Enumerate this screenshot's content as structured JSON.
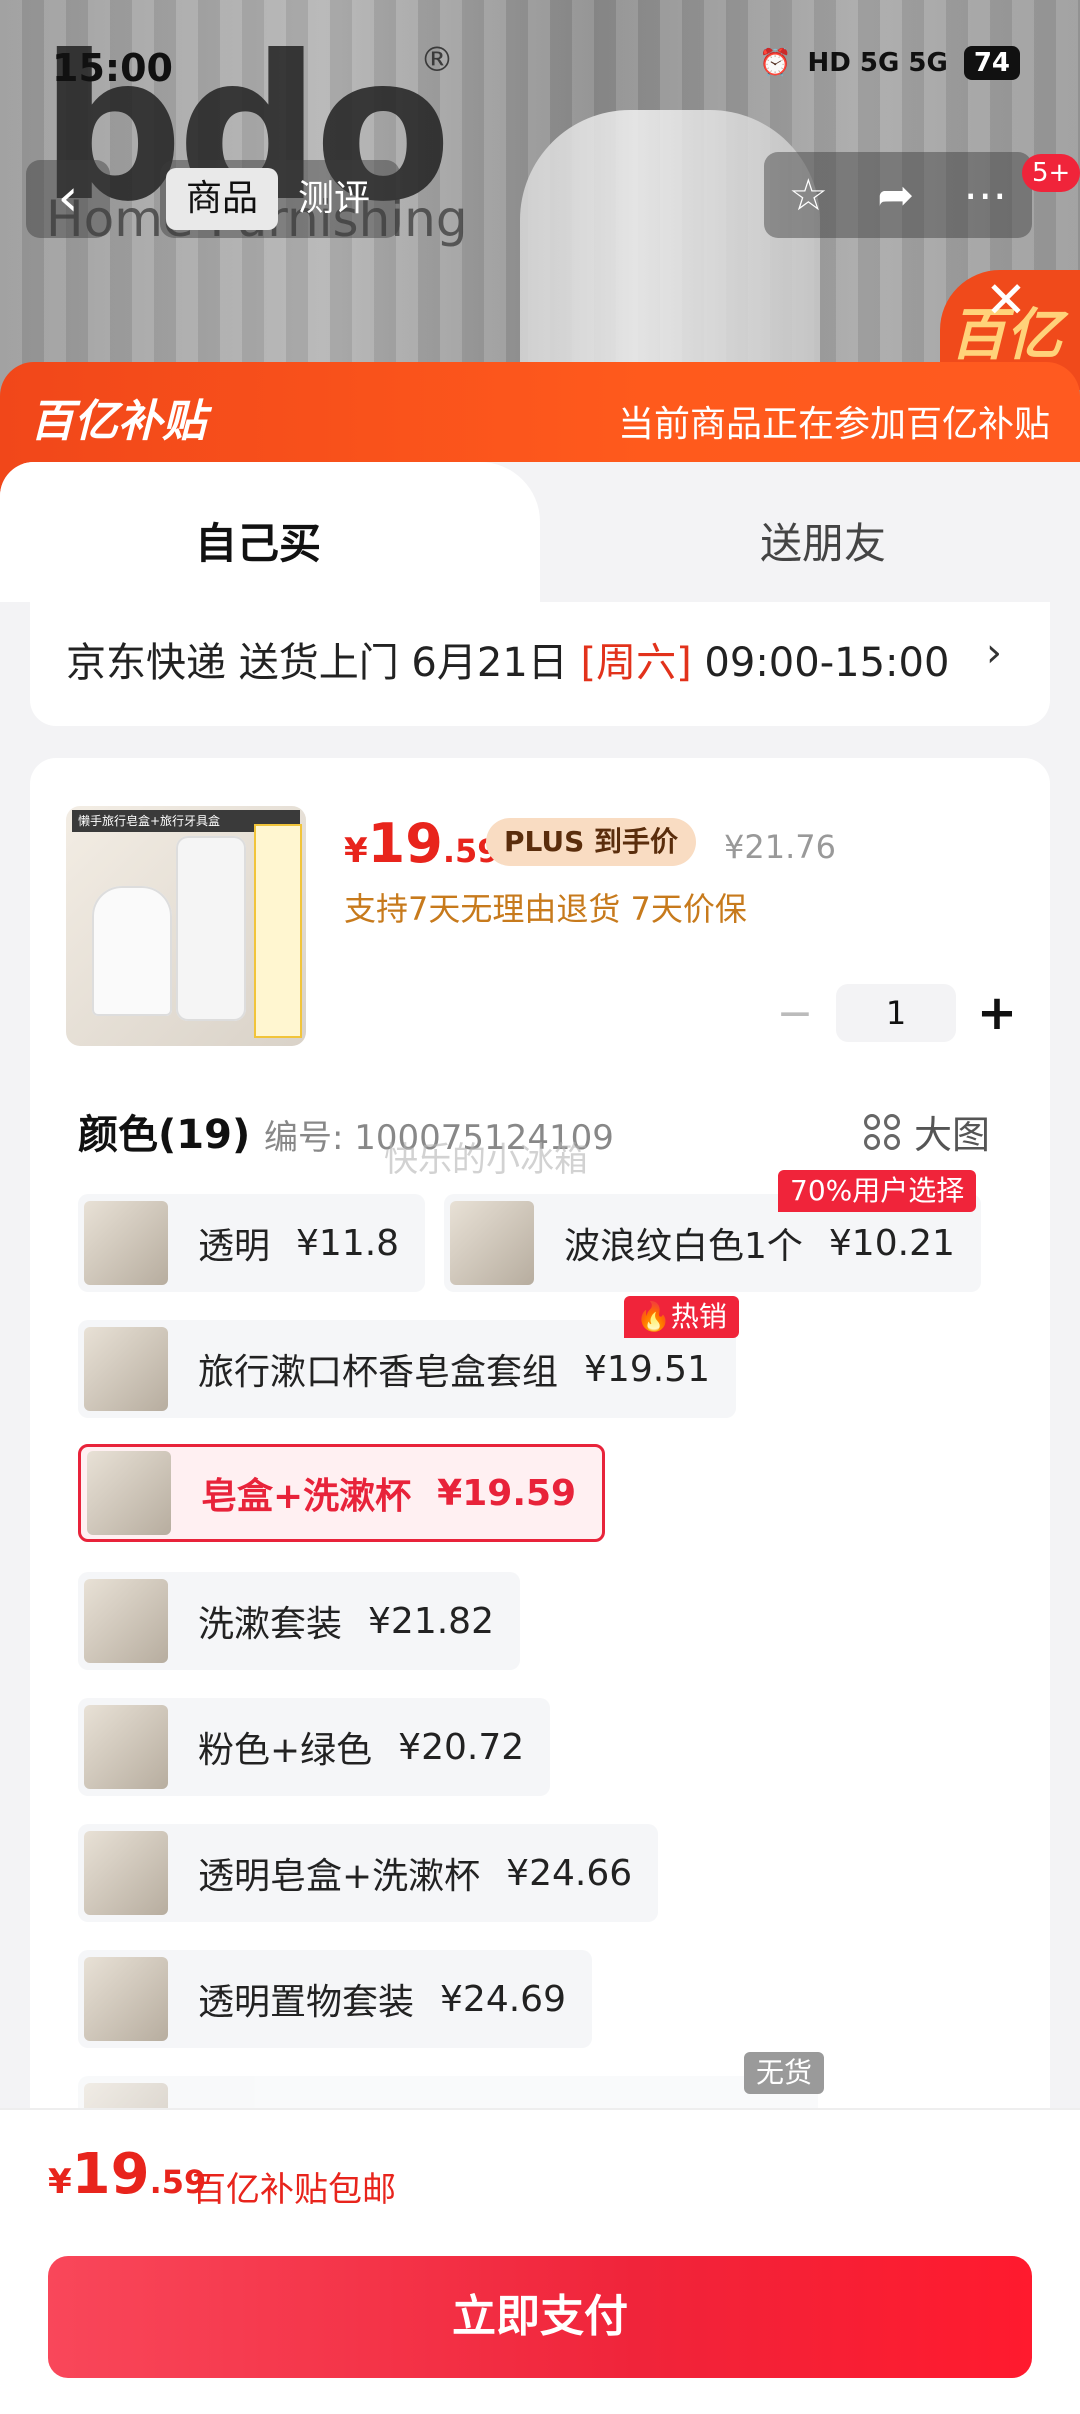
{
  "status_bar": {
    "time": "15:00",
    "network": "HD 5G 5G",
    "battery": "74"
  },
  "background": {
    "brand_logo": "bdo",
    "brand_sub": "Home Furnishing",
    "reg_mark": "®",
    "badge_text": "百亿"
  },
  "nav": {
    "back_icon": "chevron-left-icon",
    "tabs": [
      "商品",
      "测评"
    ],
    "message_count": "5+"
  },
  "banner": {
    "logo_prefix": "百",
    "logo_text": "亿补贴",
    "text": "当前商品正在参加百亿补贴"
  },
  "tabs": {
    "self": "自己买",
    "friend": "送朋友"
  },
  "delivery": {
    "text": "京东快递 送货上门 6月21日 ",
    "weekday": "[周六]",
    "time": " 09:00-15:00",
    "arrow": "›"
  },
  "product": {
    "thumb_header": "懒手旅行皂盒+旅行牙具盒",
    "price_currency": "¥",
    "price_int": "19",
    "price_dec": ".59",
    "plus_label": "PLUS 到手价",
    "original_price": "¥21.76",
    "guarantee": "支持7天无理由退货  7天价保",
    "quantity": "1"
  },
  "colors": {
    "title": "颜色(19)",
    "code": "编号: 100075124109",
    "watermark": "快乐的小冰箱",
    "big_image_label": "大图",
    "options": [
      {
        "name": "透明",
        "price": "¥11.8"
      },
      {
        "name": "波浪纹白色1个",
        "price": "¥10.21",
        "tag": "70%用户选择"
      },
      {
        "name": "旅行漱口杯香皂盒套组",
        "price": "¥19.51",
        "tag": "🔥热销"
      },
      {
        "name": "皂盒+洗漱杯",
        "price": "¥19.59",
        "selected": true
      },
      {
        "name": "洗漱套装",
        "price": "¥21.82"
      },
      {
        "name": "粉色+绿色",
        "price": "¥20.72"
      },
      {
        "name": "透明皂盒+洗漱杯",
        "price": "¥24.66"
      },
      {
        "name": "透明置物套装",
        "price": "¥24.69"
      },
      {
        "name": "",
        "price": "",
        "tag": "无货"
      }
    ]
  },
  "bottom": {
    "price_currency": "¥",
    "price_int": "19",
    "price_dec": ".59",
    "note": "百亿补贴包邮",
    "pay_label": "立即支付"
  },
  "colors_palette": {
    "accent": "#f0243a",
    "banner": "#ff5a1c",
    "guarantee": "#c77a1c"
  }
}
